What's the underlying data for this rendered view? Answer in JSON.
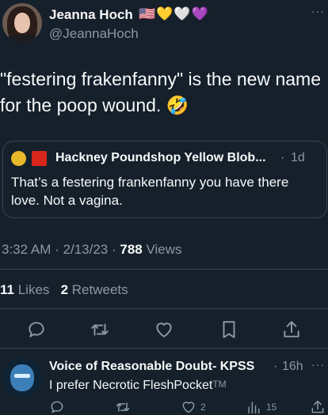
{
  "author": {
    "name": "Jeanna Hoch",
    "badges": "🇺🇸💛🤍💜",
    "handle": "@JeannaHoch",
    "more": "···"
  },
  "tweet": {
    "text": "\"festering frakenfanny\" is the new name for the poop wound. 🤣"
  },
  "quote": {
    "name": "Hackney Poundshop Yellow Blob...",
    "separator": "·",
    "time": "1d",
    "text": "That’s a festering frankenfanny you have there love. Not a vagina."
  },
  "meta": {
    "time": "3:32 AM",
    "date": "2/13/23",
    "views_count": "788",
    "views_label": "Views",
    "sep": "·"
  },
  "stats": {
    "likes_count": "11",
    "likes_label": "Likes",
    "retweets_count": "2",
    "retweets_label": "Retweets"
  },
  "reply": {
    "name": "Voice of Reasonable Doubt- KPSS",
    "separator": "·",
    "time": "16h",
    "more": "···",
    "text": "I prefer Necrotic FleshPocket",
    "tm": "TM",
    "likes": "2",
    "views": "15"
  },
  "colors": {
    "background": "#15202b",
    "text": "#f7f9f9",
    "muted": "#8b98a5",
    "divider": "#38444d"
  },
  "icons": [
    "reply-icon",
    "retweet-icon",
    "like-icon",
    "bookmark-icon",
    "share-icon",
    "views-icon"
  ]
}
